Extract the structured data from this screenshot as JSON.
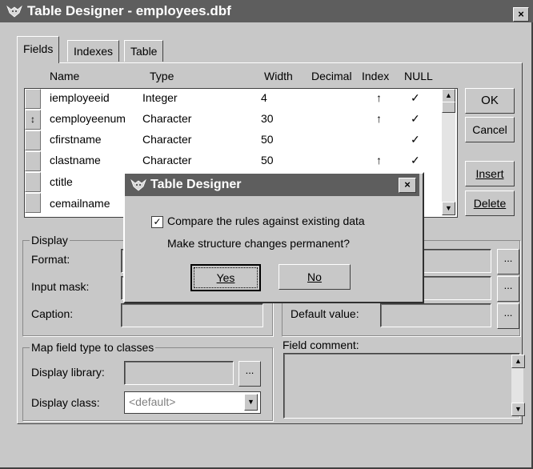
{
  "window": {
    "title": "Table Designer - employees.dbf",
    "close_label": "×"
  },
  "tabs": [
    {
      "label": "Fields"
    },
    {
      "label": "Indexes"
    },
    {
      "label": "Table"
    }
  ],
  "grid": {
    "columns": [
      "Name",
      "Type",
      "Width",
      "Decimal",
      "Index",
      "NULL"
    ],
    "rows": [
      {
        "name": "iemployeeid",
        "type": "Integer",
        "width": "4",
        "decimal": "",
        "index": "↑",
        "null": "✓",
        "selector": ""
      },
      {
        "name": "cemployeenum",
        "type": "Character",
        "width": "30",
        "decimal": "",
        "index": "↑",
        "null": "✓",
        "selector": "↕"
      },
      {
        "name": "cfirstname",
        "type": "Character",
        "width": "50",
        "decimal": "",
        "index": "",
        "null": "✓",
        "selector": ""
      },
      {
        "name": "clastname",
        "type": "Character",
        "width": "50",
        "decimal": "",
        "index": "↑",
        "null": "✓",
        "selector": ""
      },
      {
        "name": "ctitle",
        "type": "",
        "width": "",
        "decimal": "",
        "index": "",
        "null": "",
        "selector": ""
      },
      {
        "name": "cemailname",
        "type": "",
        "width": "",
        "decimal": "",
        "index": "",
        "null": "",
        "selector": ""
      }
    ],
    "scroll_up": "▲",
    "scroll_down": "▼"
  },
  "buttons": {
    "ok": "OK",
    "cancel": "Cancel",
    "insert": "Insert",
    "delete": "Delete"
  },
  "display_group": {
    "legend": "Display",
    "format_label": "Format:",
    "input_mask_label": "Input mask:",
    "caption_label": "Caption:"
  },
  "rules_group": {
    "default_value_label": "Default value:",
    "ellipsis": "..."
  },
  "map_group": {
    "legend": "Map field type to classes",
    "display_library_label": "Display library:",
    "display_class_label": "Display class:",
    "display_class_value": "<default>",
    "dropdown_arrow": "▼"
  },
  "comment": {
    "label": "Field comment:"
  },
  "dialog": {
    "title": "Table Designer",
    "close_label": "×",
    "checkbox_label": "Compare the rules against existing data",
    "checkbox_checked": "✓",
    "question": "Make structure changes permanent?",
    "yes_label": "Yes",
    "no_label": "No"
  }
}
